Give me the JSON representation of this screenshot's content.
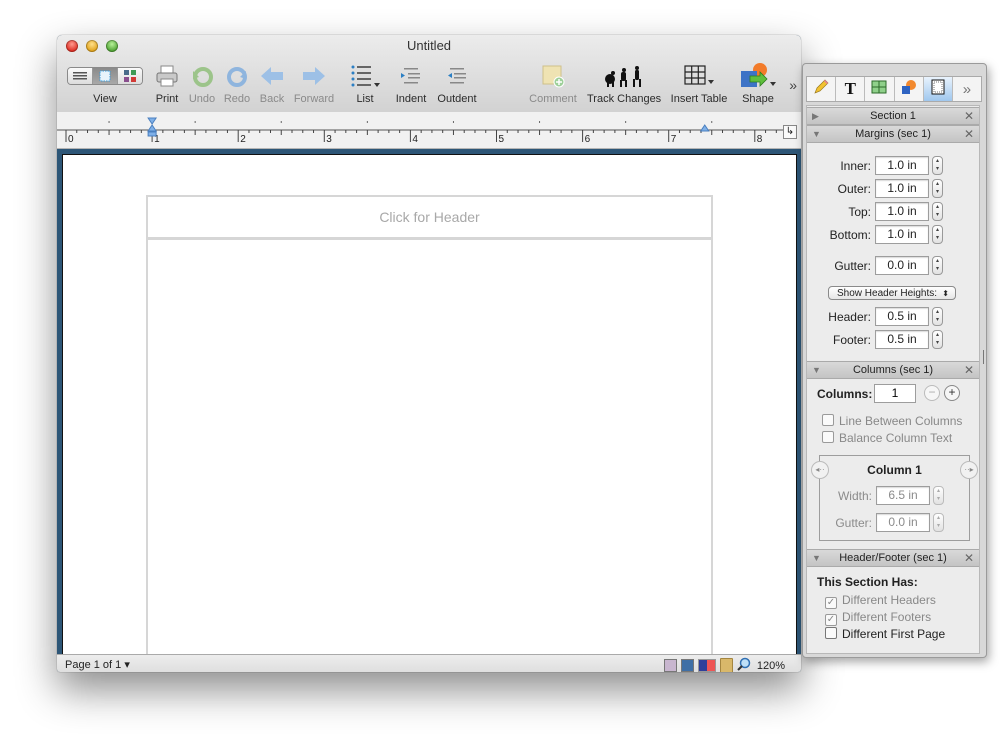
{
  "window": {
    "title": "Untitled"
  },
  "toolbar": {
    "items": [
      {
        "id": "view",
        "label": "View",
        "icon": "view-mode-segmented",
        "enabled": true
      },
      {
        "id": "print",
        "label": "Print",
        "icon": "printer-icon",
        "enabled": true
      },
      {
        "id": "undo",
        "label": "Undo",
        "icon": "undo-icon",
        "enabled": false
      },
      {
        "id": "redo",
        "label": "Redo",
        "icon": "redo-icon",
        "enabled": false
      },
      {
        "id": "back",
        "label": "Back",
        "icon": "back-arrow-icon",
        "enabled": false
      },
      {
        "id": "forward",
        "label": "Forward",
        "icon": "forward-arrow-icon",
        "enabled": false
      },
      {
        "id": "list",
        "label": "List",
        "icon": "bulleted-list-icon",
        "enabled": true
      },
      {
        "id": "indent",
        "label": "Indent",
        "icon": "indent-icon",
        "enabled": true
      },
      {
        "id": "outdent",
        "label": "Outdent",
        "icon": "outdent-icon",
        "enabled": true
      },
      {
        "id": "comment",
        "label": "Comment",
        "icon": "comment-note-icon",
        "enabled": false
      },
      {
        "id": "track_changes",
        "label": "Track Changes",
        "icon": "evolution-silhouettes-icon",
        "enabled": true
      },
      {
        "id": "insert_table",
        "label": "Insert Table",
        "icon": "table-grid-icon",
        "enabled": true
      },
      {
        "id": "shape",
        "label": "Shape",
        "icon": "shape-icon",
        "enabled": true
      }
    ],
    "overflow_glyph": "»",
    "view_modes": [
      "draft",
      "page-layout",
      "thumbnails"
    ],
    "view_mode_selected": "page-layout"
  },
  "ruler": {
    "labels": [
      "0",
      "1",
      "2",
      "3",
      "4",
      "5",
      "6",
      "7",
      "8"
    ],
    "units": "inches",
    "left_indent_in": 1.0,
    "right_indent_in": 7.5,
    "corner_glyph": "↳"
  },
  "document": {
    "header_placeholder": "Click for Header"
  },
  "statusbar": {
    "page_info": "Page 1 of 1",
    "page_menu_glyph": "▾",
    "zoom": "120%"
  },
  "inspector": {
    "tabs": [
      {
        "id": "pencil",
        "icon": "pencil-icon",
        "active": false
      },
      {
        "id": "text",
        "icon": "text-T-icon",
        "glyph": "T",
        "active": false
      },
      {
        "id": "table",
        "icon": "table-icon",
        "active": false
      },
      {
        "id": "graphic",
        "icon": "graphic-shapes-icon",
        "active": false
      },
      {
        "id": "layout",
        "icon": "page-layout-icon",
        "active": true
      },
      {
        "id": "more",
        "icon": "more-chevron-icon",
        "glyph": "»",
        "active": false
      }
    ],
    "sections": {
      "section": {
        "title": "Section 1",
        "expanded": false
      },
      "margins": {
        "title": "Margins (sec 1)",
        "expanded": true,
        "fields": [
          {
            "label": "Inner:",
            "value": "1.0 in"
          },
          {
            "label": "Outer:",
            "value": "1.0 in"
          },
          {
            "label": "Top:",
            "value": "1.0 in"
          },
          {
            "label": "Bottom:",
            "value": "1.0 in"
          },
          {
            "label": "Gutter:",
            "value": "0.0 in"
          }
        ],
        "header_heights_popup": "Show Header Heights:",
        "header": {
          "label": "Header:",
          "value": "0.5 in"
        },
        "footer": {
          "label": "Footer:",
          "value": "0.5 in"
        }
      },
      "columns": {
        "title": "Columns (sec 1)",
        "expanded": true,
        "columns_label": "Columns:",
        "columns_value": "1",
        "line_between": {
          "label": "Line Between Columns",
          "checked": false,
          "enabled": false
        },
        "balance_text": {
          "label": "Balance Column Text",
          "checked": false,
          "enabled": false
        },
        "column_title": "Column 1",
        "width": {
          "label": "Width:",
          "value": "6.5 in"
        },
        "gutter": {
          "label": "Gutter:",
          "value": "0.0 in"
        }
      },
      "header_footer": {
        "title": "Header/Footer (sec 1)",
        "expanded": true,
        "section_has_label": "This Section Has:",
        "options": [
          {
            "label": "Different Headers",
            "checked": true,
            "enabled": false
          },
          {
            "label": "Different Footers",
            "checked": true,
            "enabled": false
          },
          {
            "label": "Different First Page",
            "checked": false,
            "enabled": true
          }
        ]
      }
    }
  }
}
